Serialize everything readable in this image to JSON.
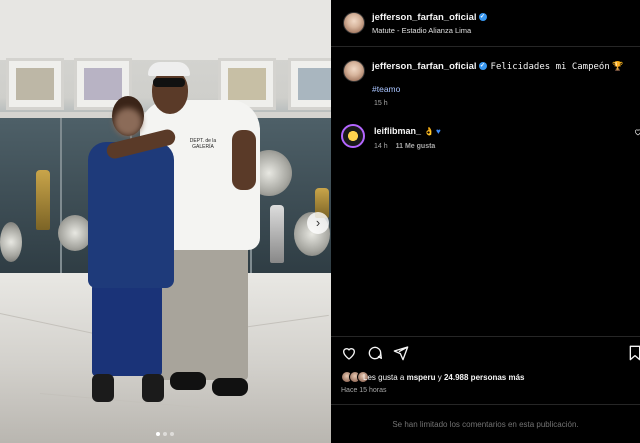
{
  "post": {
    "author": "jefferson_farfan_oficial",
    "location": "Matute - Estadio Alianza Lima",
    "caption_user": "jefferson_farfan_oficial",
    "caption_text": "Felicidades mi Campeón",
    "caption_emoji": "trophy",
    "hashtag": "#teamo",
    "caption_time": "15 h",
    "image_description_print": "DEPT. de la GALERÍA"
  },
  "comments": [
    {
      "user": "leiflibman_",
      "emojis": [
        "ok-hand",
        "blue-heart"
      ],
      "time": "14 h",
      "likes": "11 Me gusta"
    }
  ],
  "actions": {
    "icons": [
      "heart-icon",
      "comment-icon",
      "share-icon",
      "bookmark-icon"
    ]
  },
  "likes": {
    "prefix": "Les gusta a",
    "user": "msperu",
    "connector": "y",
    "others": "24.988 personas más"
  },
  "time_ago": "Hace 15 horas",
  "comments_limited": "Se han limitado los comentarios en esta publicación.",
  "carousel": {
    "total": 3,
    "active": 1
  },
  "colors": {
    "background": "#000000",
    "text": "#f5f5f5",
    "muted": "#a8a8a8",
    "hashtag": "#a9c4ff",
    "verified": "#3897f0"
  }
}
